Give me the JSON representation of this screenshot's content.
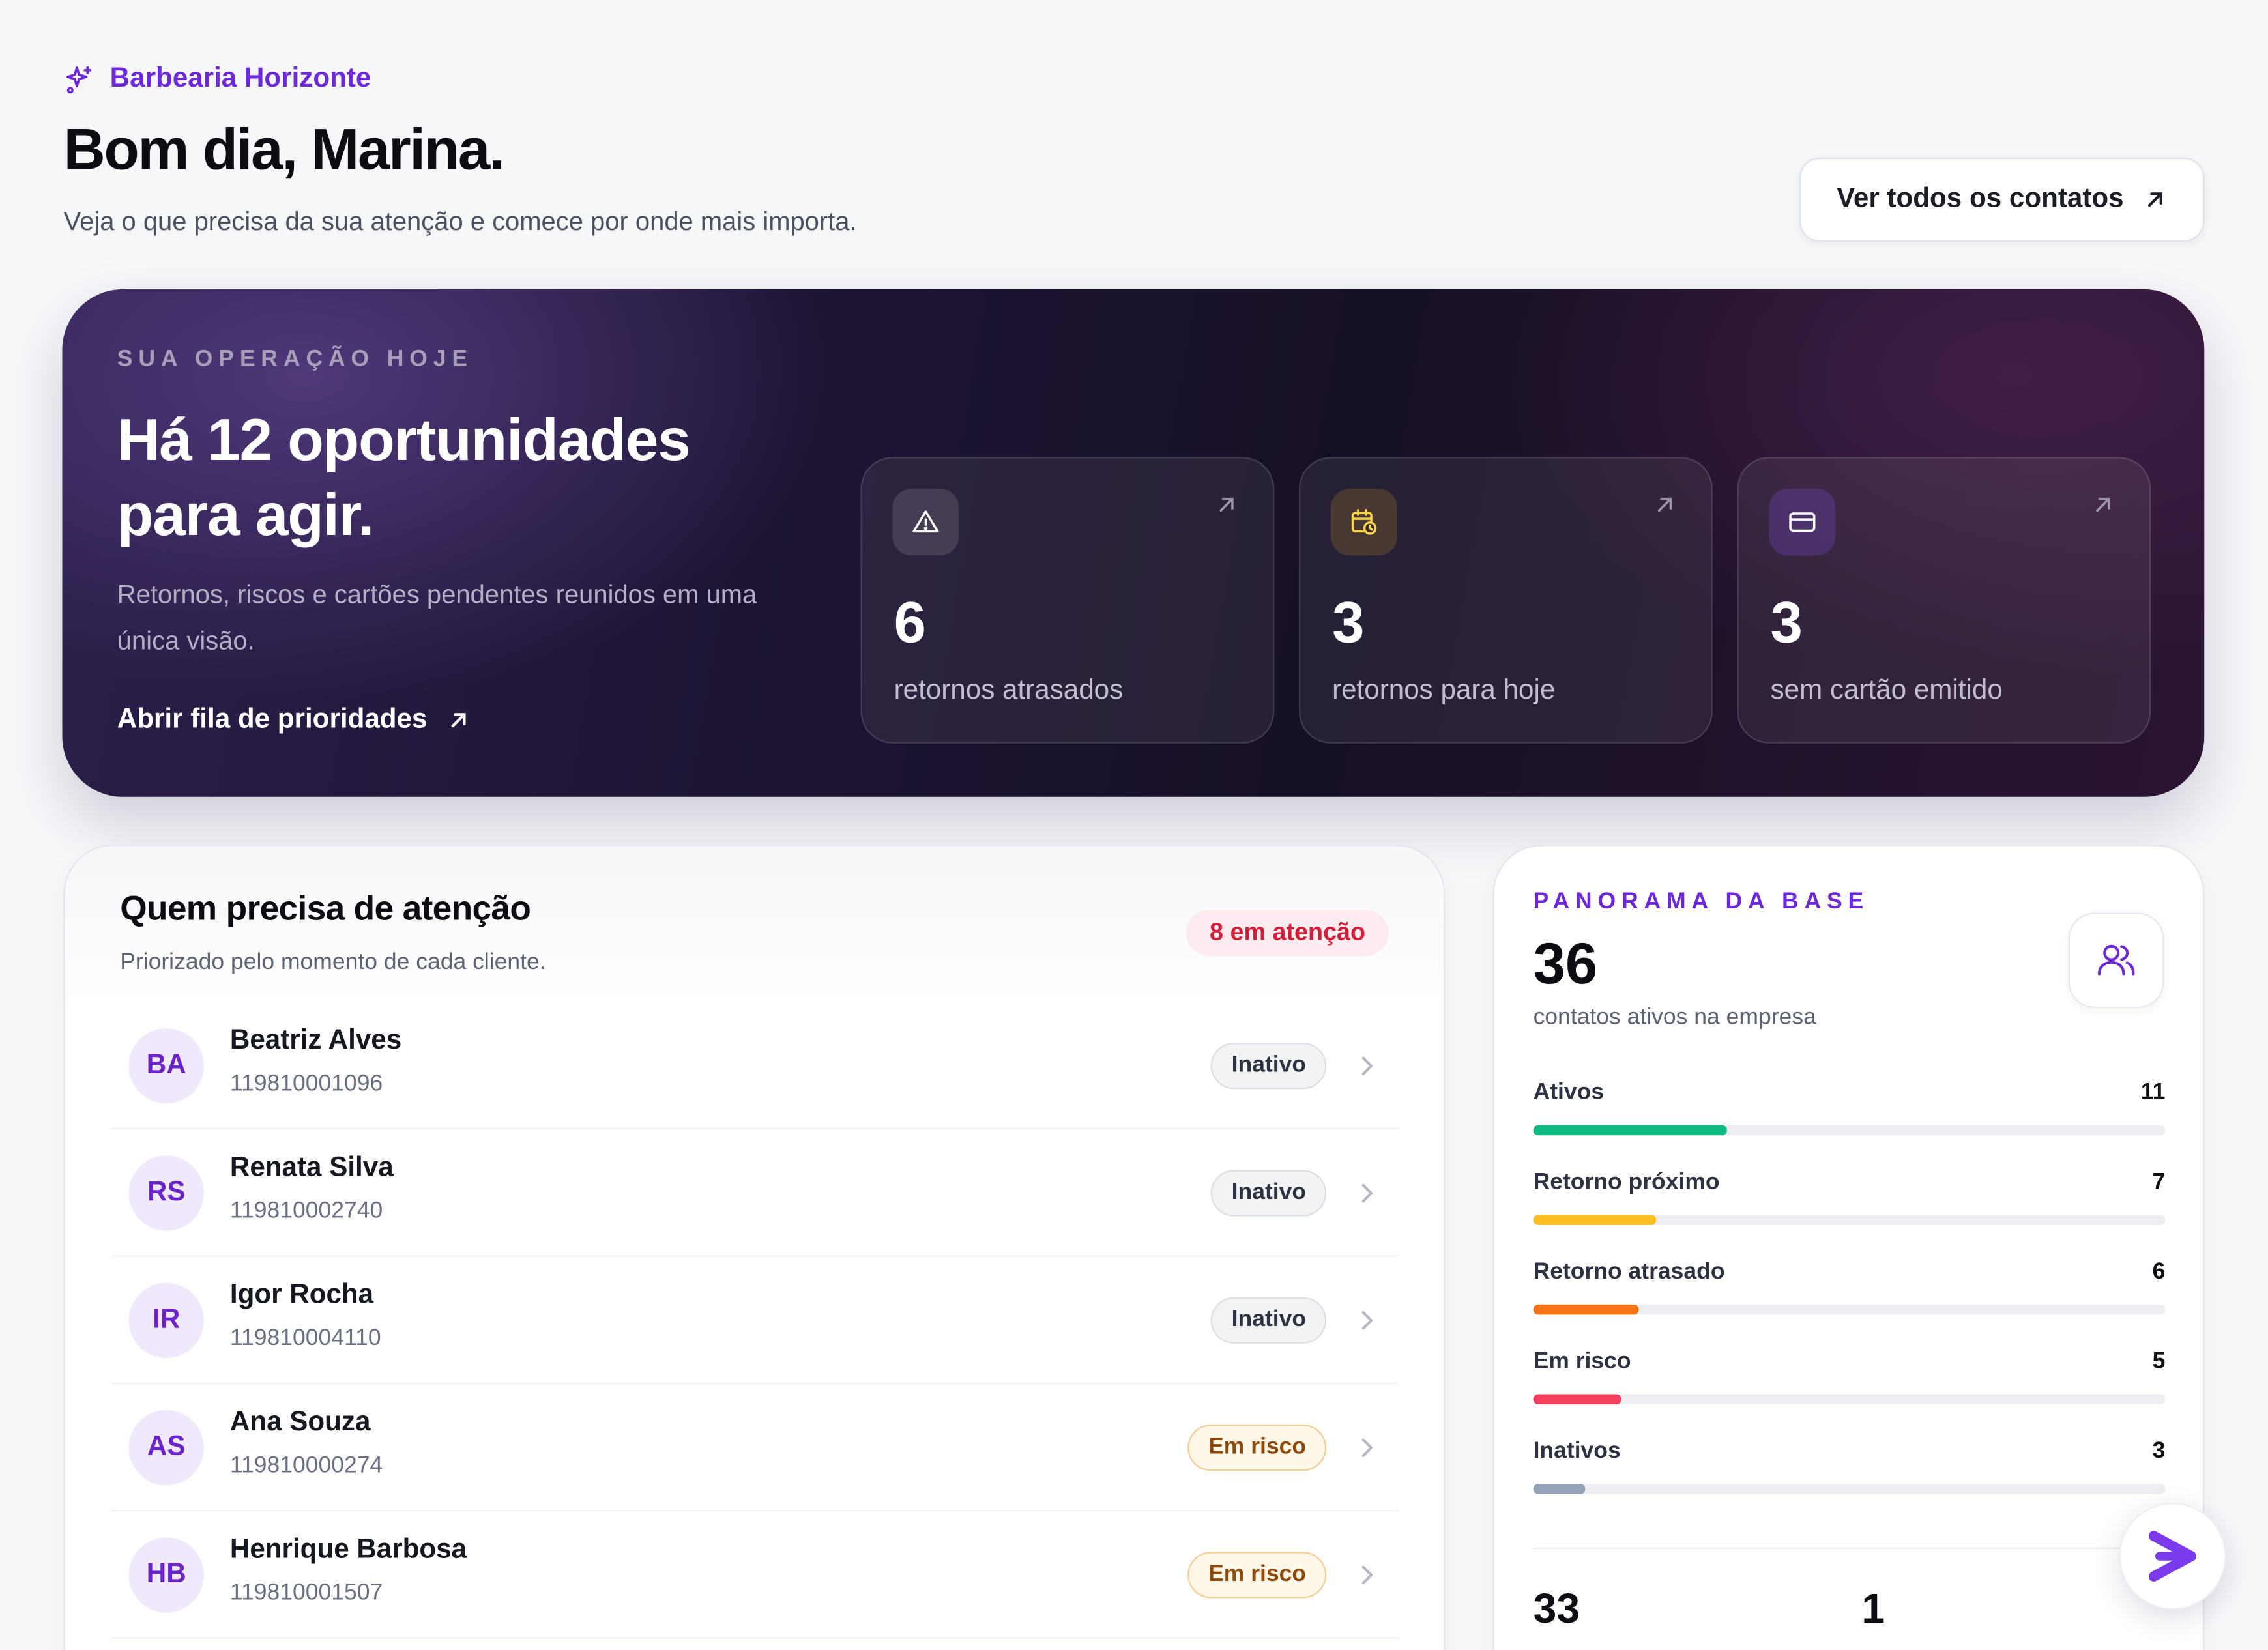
{
  "header": {
    "brand": "Barbearia Horizonte",
    "greeting": "Bom dia, Marina.",
    "subtitle": "Veja o que precisa da sua atenção e comece por onde mais importa.",
    "contacts_button": "Ver todos os contatos"
  },
  "hero": {
    "eyebrow": "SUA OPERAÇÃO HOJE",
    "title": "Há 12 oportunidades para agir.",
    "description": "Retornos, riscos e cartões pendentes reunidos em uma única visão.",
    "link": "Abrir fila de prioridades",
    "stats": [
      {
        "value": "6",
        "label": "retornos atrasados",
        "icon": "warning-icon"
      },
      {
        "value": "3",
        "label": "retornos para hoje",
        "icon": "calendar-clock-icon"
      },
      {
        "value": "3",
        "label": "sem cartão emitido",
        "icon": "card-icon"
      }
    ]
  },
  "attention": {
    "title": "Quem precisa de atenção",
    "subtitle": "Priorizado pelo momento de cada cliente.",
    "badge": "8 em atenção",
    "rows": [
      {
        "initials": "BA",
        "name": "Beatriz Alves",
        "phone": "119810001096",
        "status": "Inativo"
      },
      {
        "initials": "RS",
        "name": "Renata Silva",
        "phone": "119810002740",
        "status": "Inativo"
      },
      {
        "initials": "IR",
        "name": "Igor Rocha",
        "phone": "119810004110",
        "status": "Inativo"
      },
      {
        "initials": "AS",
        "name": "Ana Souza",
        "phone": "119810000274",
        "status": "Em risco"
      },
      {
        "initials": "HB",
        "name": "Henrique Barbosa",
        "phone": "119810001507",
        "status": "Em risco"
      }
    ]
  },
  "panorama": {
    "eyebrow": "PANORAMA DA BASE",
    "total": "36",
    "subtitle": "contatos ativos na empresa",
    "scale_max": 36,
    "metrics": [
      {
        "label": "Ativos",
        "value": "11",
        "color": "#10b981"
      },
      {
        "label": "Retorno próximo",
        "value": "7",
        "color": "#fbbf24"
      },
      {
        "label": "Retorno atrasado",
        "value": "6",
        "color": "#f97316"
      },
      {
        "label": "Em risco",
        "value": "5",
        "color": "#f43f5e"
      },
      {
        "label": "Inativos",
        "value": "3",
        "color": "#94a3b8"
      }
    ],
    "bottom_left": "33",
    "bottom_right": "1"
  },
  "colors": {
    "accent": "#6d28d9",
    "alert": "#d11f3a"
  }
}
